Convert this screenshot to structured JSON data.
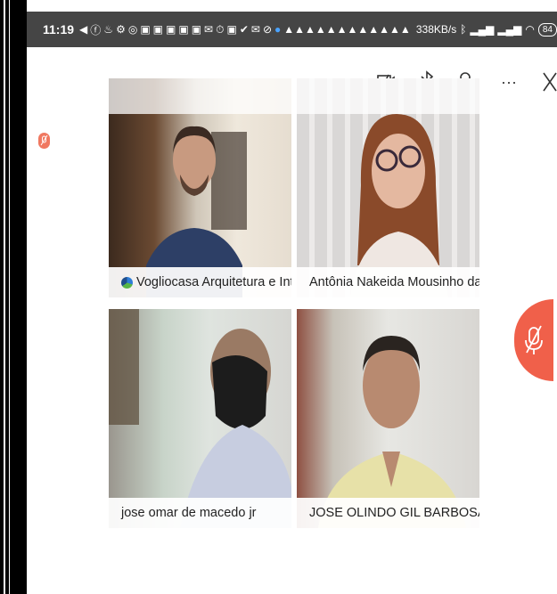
{
  "status_bar": {
    "time": "11:19",
    "network_speed": "338KB/s",
    "battery": "84"
  },
  "toolbar": {
    "camera_off_icon": "camera-off-icon",
    "bluetooth_icon": "bluetooth-icon",
    "participants_icon": "participants-icon",
    "more_label": "···",
    "close_label": "X"
  },
  "participants": [
    {
      "name": "Vogliocasa Arquitetura e Interiores"
    },
    {
      "name": "Antônia Nakeida  Mousinho da Silva ("
    },
    {
      "name": "jose omar de macedo jr"
    },
    {
      "name": "JOSE OLINDO GIL BARBOSA (eu)"
    }
  ],
  "colors": {
    "status_bg": "#454545",
    "mute_accent": "#f0604a"
  }
}
